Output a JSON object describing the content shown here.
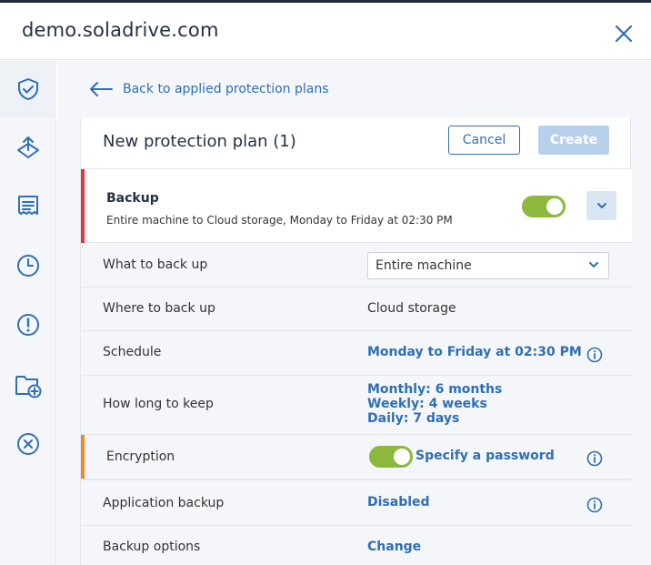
{
  "header": {
    "title": "demo.soladrive.com"
  },
  "sidebar": {
    "items": [
      {
        "icon": "shield-check-icon"
      },
      {
        "icon": "upload-icon"
      },
      {
        "icon": "document-icon"
      },
      {
        "icon": "clock-icon"
      },
      {
        "icon": "alert-icon"
      },
      {
        "icon": "folder-add-icon"
      },
      {
        "icon": "cancel-circle-icon"
      }
    ]
  },
  "nav": {
    "back_label": "Back to applied protection plans"
  },
  "plan": {
    "title": "New protection plan (1)",
    "cancel_label": "Cancel",
    "create_label": "Create",
    "backup": {
      "title": "Backup",
      "summary": "Entire machine to Cloud storage, Monday to Friday at 02:30 PM",
      "enabled": true
    },
    "rows": {
      "what": {
        "label": "What to back up",
        "value": "Entire machine"
      },
      "where": {
        "label": "Where to back up",
        "value": "Cloud storage"
      },
      "schedule": {
        "label": "Schedule",
        "value": "Monday to Friday at 02:30 PM"
      },
      "keep": {
        "label": "How long to keep",
        "monthly": "Monthly: 6 months",
        "weekly": "Weekly: 4 weeks",
        "daily": "Daily: 7 days"
      },
      "encryption": {
        "label": "Encryption",
        "value": "Specify a password",
        "enabled": true
      },
      "app_backup": {
        "label": "Application backup",
        "value": "Disabled"
      },
      "options": {
        "label": "Backup options",
        "value": "Change"
      }
    }
  },
  "colors": {
    "accent": "#2f6fb5",
    "toggle_on": "#8bb83d",
    "backup_stripe": "#e0343f",
    "encryption_stripe": "#f08a24"
  }
}
